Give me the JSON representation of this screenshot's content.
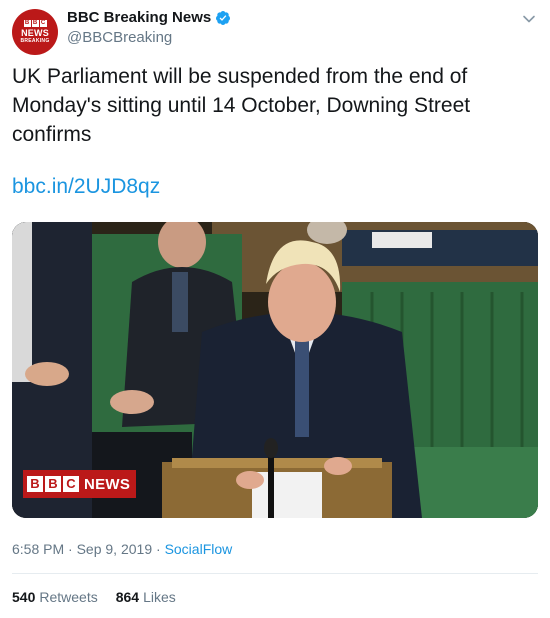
{
  "author": {
    "name": "BBC Breaking News",
    "handle": "@BBCBreaking",
    "verified": true,
    "avatar": {
      "letters": [
        "B",
        "B",
        "C"
      ],
      "news": "NEWS",
      "breaking": "BREAKING"
    }
  },
  "tweet": {
    "text": "UK Parliament will be suspended from the end of Monday's sitting until 14 October, Downing Street confirms",
    "link": "bbc.in/2UJD8qz"
  },
  "media": {
    "logo_letters": [
      "B",
      "B",
      "C"
    ],
    "logo_word": "NEWS"
  },
  "meta": {
    "time": "6:58 PM",
    "separator": "·",
    "date": "Sep 9, 2019",
    "source": "SocialFlow"
  },
  "stats": {
    "retweets_count": "540",
    "retweets_label": "Retweets",
    "likes_count": "864",
    "likes_label": "Likes"
  },
  "colors": {
    "brand_red": "#bb1919",
    "link_blue": "#1b95e0",
    "muted_gray": "#657786",
    "bench_green": "#2f6b3f"
  },
  "icons": [
    "verified-badge-icon",
    "chevron-down-icon"
  ]
}
